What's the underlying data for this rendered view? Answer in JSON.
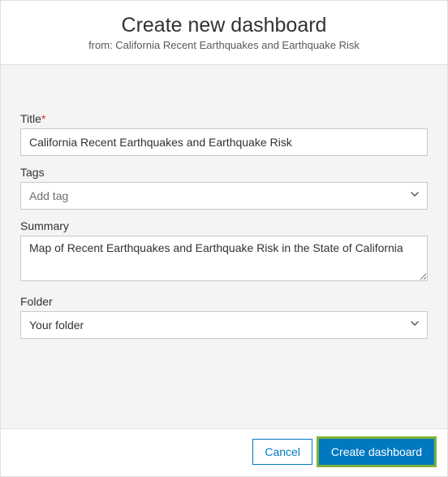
{
  "header": {
    "title": "Create new dashboard",
    "from_prefix": "from: ",
    "from_name": "California Recent Earthquakes and Earthquake Risk"
  },
  "form": {
    "title_label": "Title",
    "title_required_mark": "*",
    "title_value": "California Recent Earthquakes and Earthquake Risk",
    "tags_label": "Tags",
    "tags_placeholder": "Add tag",
    "summary_label": "Summary",
    "summary_value": "Map of Recent Earthquakes and Earthquake Risk in the State of California",
    "folder_label": "Folder",
    "folder_value": "Your folder"
  },
  "footer": {
    "cancel_label": "Cancel",
    "create_label": "Create dashboard"
  }
}
